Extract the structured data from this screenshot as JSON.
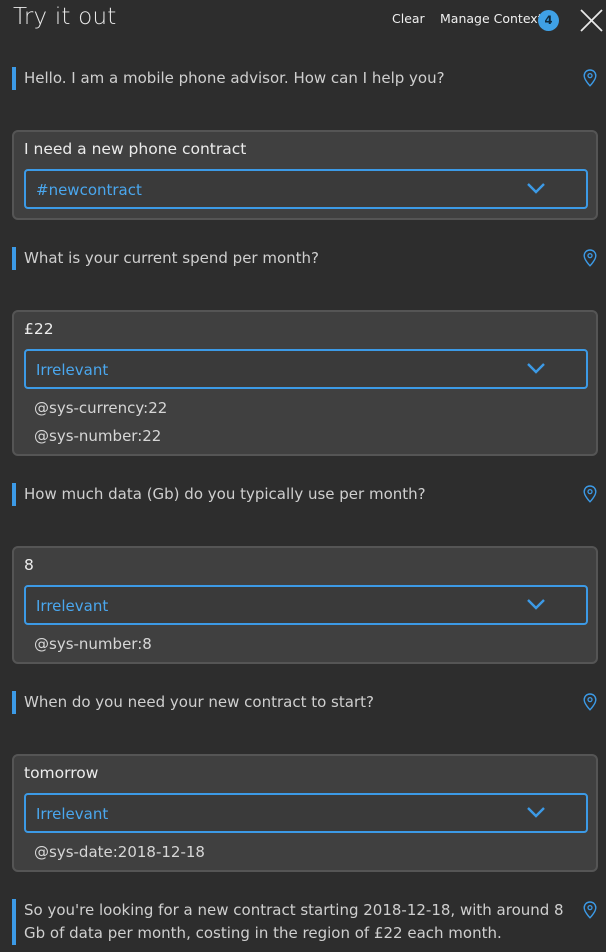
{
  "header": {
    "title": "Try it out",
    "clear_label": "Clear",
    "manage_context_label": "Manage Context",
    "context_count": "4"
  },
  "colors": {
    "background": "#2d2d2d",
    "accent": "#3c9ae6",
    "card": "#404040"
  },
  "conversation": [
    {
      "type": "bot",
      "text": "Hello. I am a mobile phone advisor. How can I help you?"
    },
    {
      "type": "user",
      "text": "I need a new phone contract",
      "intent": "#newcontract",
      "entities": []
    },
    {
      "type": "bot",
      "text": "What is your current spend per month?"
    },
    {
      "type": "user",
      "text": "£22",
      "intent": "Irrelevant",
      "entities": [
        "@sys-currency:22",
        "@sys-number:22"
      ]
    },
    {
      "type": "bot",
      "text": "How much data (Gb) do you typically use per month?"
    },
    {
      "type": "user",
      "text": "8",
      "intent": "Irrelevant",
      "entities": [
        "@sys-number:8"
      ]
    },
    {
      "type": "bot",
      "text": "When do you need your new contract to start?"
    },
    {
      "type": "user",
      "text": "tomorrow",
      "intent": "Irrelevant",
      "entities": [
        "@sys-date:2018-12-18"
      ]
    },
    {
      "type": "bot",
      "text": "So you're looking for a new contract starting 2018-12-18, with around 8 Gb of data per month, costing in the region of £22 each month."
    }
  ],
  "icons": {
    "close": "close-icon",
    "pin": "location-pin-icon",
    "chevron": "chevron-down-icon"
  }
}
